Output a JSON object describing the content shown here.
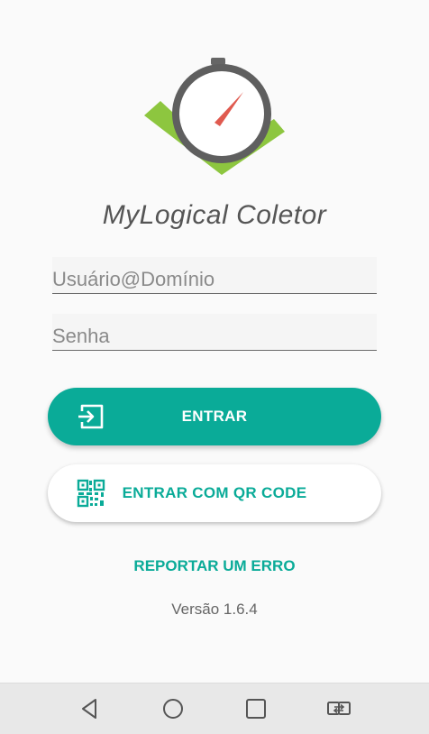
{
  "app": {
    "title": "MyLogical Coletor",
    "colors": {
      "accent": "#0aab98",
      "logo_green": "#8dc63f",
      "needle": "#e05a4f"
    }
  },
  "form": {
    "username_placeholder": "Usuário@Domínio",
    "password_placeholder": "Senha"
  },
  "buttons": {
    "login_label": "ENTRAR",
    "login_icon": "login-icon",
    "qr_login_label": "ENTRAR COM QR CODE",
    "qr_icon": "qr-code-icon"
  },
  "links": {
    "report_error": "REPORTAR UM ERRO"
  },
  "footer": {
    "version": "Versão 1.6.4"
  },
  "navbar": {
    "icons": [
      "back-icon",
      "home-icon",
      "recents-icon",
      "switch-app-icon"
    ]
  }
}
